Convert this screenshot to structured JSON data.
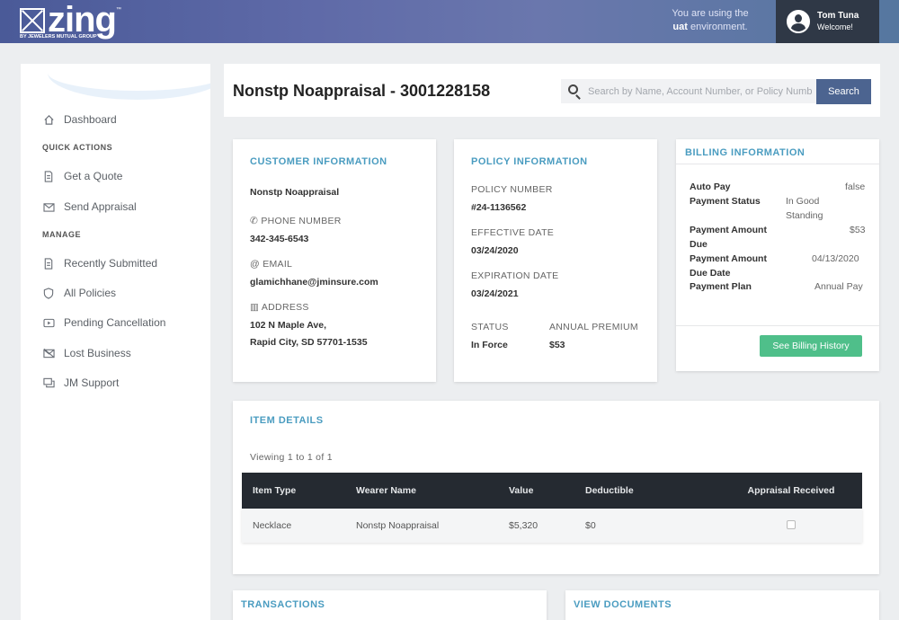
{
  "header": {
    "logo_text": "zing",
    "logo_tm": "™",
    "logo_sub": "BY JEWELERS MUTUAL GROUP",
    "env_line1": "You are using the",
    "env_name": "uat",
    "env_line2": "environment.",
    "user_name": "Tom Tuna",
    "user_welcome": "Welcome!"
  },
  "sidebar": {
    "dashboard": "Dashboard",
    "quick_actions": "QUICK ACTIONS",
    "get_quote": "Get a Quote",
    "send_appraisal": "Send Appraisal",
    "manage": "MANAGE",
    "recently_submitted": "Recently Submitted",
    "all_policies": "All Policies",
    "pending_cancellation": "Pending Cancellation",
    "lost_business": "Lost Business",
    "jm_support": "JM Support"
  },
  "page": {
    "title": "Nonstp Noappraisal - 3001228158",
    "search_placeholder": "Search by Name, Account Number, or Policy Number",
    "search_button": "Search"
  },
  "customer": {
    "title": "CUSTOMER INFORMATION",
    "name": "Nonstp Noappraisal",
    "phone_label": "PHONE NUMBER",
    "phone": "342-345-6543",
    "email_label": "EMAIL",
    "email": "glamichhane@jminsure.com",
    "address_label": "ADDRESS",
    "address_line1": "102 N Maple Ave,",
    "address_line2": "Rapid City, SD 57701-1535"
  },
  "policy": {
    "title": "POLICY INFORMATION",
    "number_label": "POLICY NUMBER",
    "number": "#24-1136562",
    "effective_label": "EFFECTIVE DATE",
    "effective": "03/24/2020",
    "expiration_label": "EXPIRATION DATE",
    "expiration": "03/24/2021",
    "status_label": "STATUS",
    "status": "In Force",
    "premium_label": "ANNUAL PREMIUM",
    "premium": "$53"
  },
  "billing": {
    "title": "BILLING INFORMATION",
    "auto_pay_label": "Auto Pay",
    "auto_pay": "false",
    "payment_status_label": "Payment Status",
    "payment_status_1": "In Good",
    "payment_status_2": "Standing",
    "amount_due_label_1": "Payment Amount",
    "amount_due_label_2": "Due",
    "amount_due": "$53",
    "due_date_label_1": "Payment Amount",
    "due_date_label_2": "Due Date",
    "due_date": "04/13/2020",
    "plan_label": "Payment Plan",
    "plan": "Annual Pay",
    "history_button": "See Billing History"
  },
  "items": {
    "title": "ITEM DETAILS",
    "viewing": "Viewing 1 to 1 of 1",
    "columns": [
      "Item Type",
      "Wearer Name",
      "Value",
      "Deductible",
      "Appraisal Received"
    ],
    "rows": [
      {
        "type": "Necklace",
        "wearer": "Nonstp Noappraisal",
        "value": "$5,320",
        "deductible": "$0"
      }
    ]
  },
  "transactions": {
    "title": "TRANSACTIONS"
  },
  "documents": {
    "title": "VIEW DOCUMENTS"
  }
}
